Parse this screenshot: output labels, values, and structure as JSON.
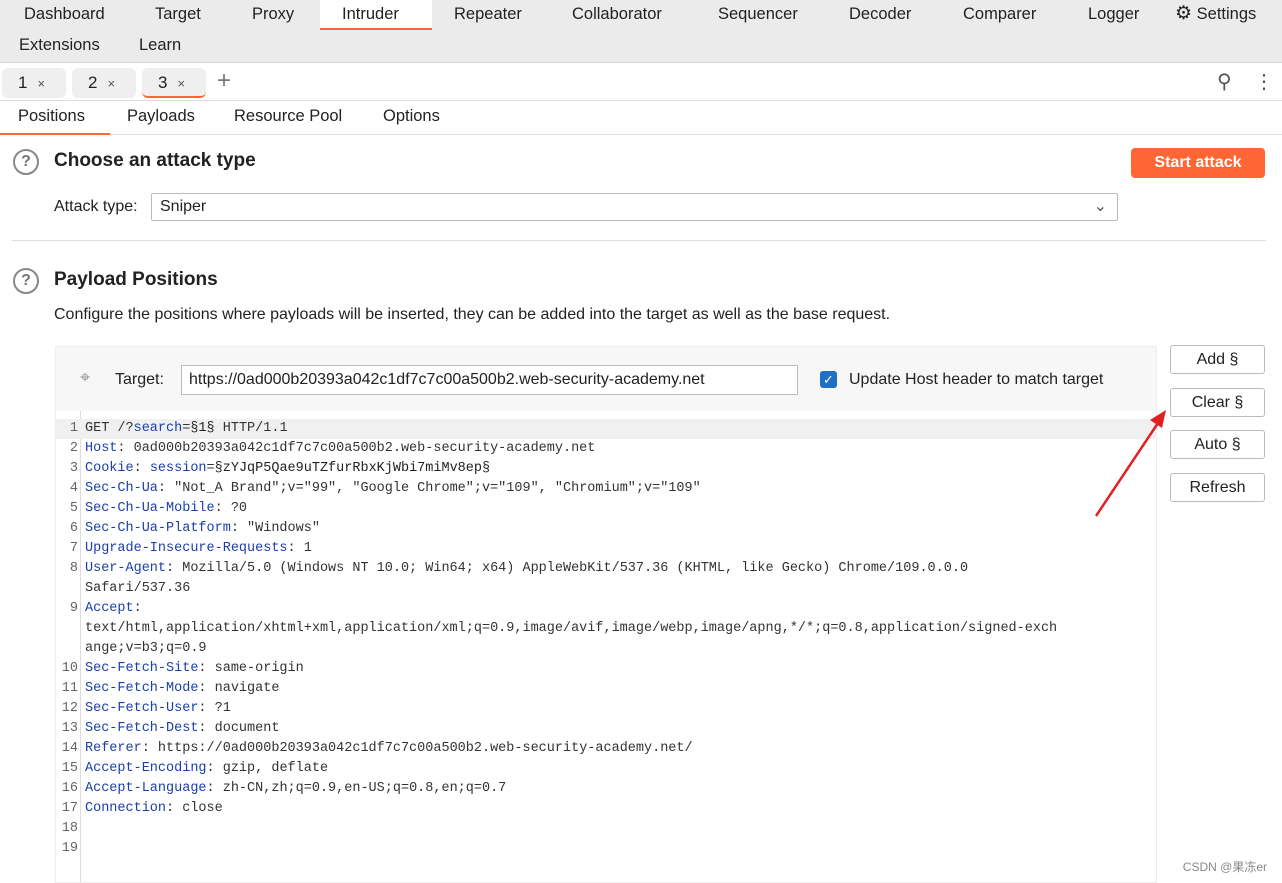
{
  "nav": {
    "items": [
      "Dashboard",
      "Target",
      "Proxy",
      "Intruder",
      "Repeater",
      "Collaborator",
      "Sequencer",
      "Decoder",
      "Comparer",
      "Logger",
      "Settings",
      "Extensions",
      "Learn"
    ],
    "active": "Intruder"
  },
  "tabs": {
    "items": [
      "1",
      "2",
      "3"
    ],
    "close": "×",
    "active": "3",
    "add": "+"
  },
  "subtabs": {
    "items": [
      "Positions",
      "Payloads",
      "Resource Pool",
      "Options"
    ],
    "active": "Positions"
  },
  "attack": {
    "title": "Choose an attack type",
    "type_label": "Attack type:",
    "type_value": "Sniper",
    "start_label": "Start attack",
    "accent": "#ff6633"
  },
  "positions": {
    "title": "Payload Positions",
    "description": "Configure the positions where payloads will be inserted, they can be added into the target as well as the base request.",
    "target_label": "Target:",
    "target_value": "https://0ad000b20393a042c1df7c7c00a500b2.web-security-academy.net",
    "update_host_label": "Update Host header to match target",
    "update_host_checked": true
  },
  "side_buttons": {
    "add": "Add §",
    "clear": "Clear §",
    "auto": "Auto §",
    "refresh": "Refresh"
  },
  "request": [
    {
      "n": "1",
      "parts": [
        [
          "p",
          "GET /?"
        ],
        [
          "k",
          "search"
        ],
        [
          "p",
          "="
        ],
        [
          "m",
          "§1§"
        ],
        [
          "p",
          " HTTP/1.1"
        ]
      ]
    },
    {
      "n": "2",
      "parts": [
        [
          "k",
          "Host"
        ],
        [
          "p",
          ": 0ad000b20393a042c1df7c7c00a500b2.web-security-academy.net"
        ]
      ]
    },
    {
      "n": "3",
      "parts": [
        [
          "k",
          "Cookie"
        ],
        [
          "p",
          ": "
        ],
        [
          "k",
          "session"
        ],
        [
          "p",
          "="
        ],
        [
          "m",
          "§zYJqP5Qae9uTZfurRbxKjWbi7miMv8ep§"
        ]
      ]
    },
    {
      "n": "4",
      "parts": [
        [
          "k",
          "Sec-Ch-Ua"
        ],
        [
          "p",
          ": \"Not_A Brand\";v=\"99\", \"Google Chrome\";v=\"109\", \"Chromium\";v=\"109\""
        ]
      ]
    },
    {
      "n": "5",
      "parts": [
        [
          "k",
          "Sec-Ch-Ua-Mobile"
        ],
        [
          "p",
          ": ?0"
        ]
      ]
    },
    {
      "n": "6",
      "parts": [
        [
          "k",
          "Sec-Ch-Ua-Platform"
        ],
        [
          "p",
          ": \"Windows\""
        ]
      ]
    },
    {
      "n": "7",
      "parts": [
        [
          "k",
          "Upgrade-Insecure-Requests"
        ],
        [
          "p",
          ": 1"
        ]
      ]
    },
    {
      "n": "8",
      "parts": [
        [
          "k",
          "User-Agent"
        ],
        [
          "p",
          ": Mozilla/5.0 (Windows NT 10.0; Win64; x64) AppleWebKit/537.36 (KHTML, like Gecko) Chrome/109.0.0.0"
        ]
      ]
    },
    {
      "n": "",
      "parts": [
        [
          "p",
          "Safari/537.36"
        ]
      ]
    },
    {
      "n": "9",
      "parts": [
        [
          "k",
          "Accept"
        ],
        [
          "p",
          ":"
        ]
      ]
    },
    {
      "n": "",
      "parts": [
        [
          "p",
          "text/html,application/xhtml+xml,application/xml;q=0.9,image/avif,image/webp,image/apng,*/*;q=0.8,application/signed-exch"
        ]
      ]
    },
    {
      "n": "",
      "parts": [
        [
          "p",
          "ange;v=b3;q=0.9"
        ]
      ]
    },
    {
      "n": "10",
      "parts": [
        [
          "k",
          "Sec-Fetch-Site"
        ],
        [
          "p",
          ": same-origin"
        ]
      ]
    },
    {
      "n": "11",
      "parts": [
        [
          "k",
          "Sec-Fetch-Mode"
        ],
        [
          "p",
          ": navigate"
        ]
      ]
    },
    {
      "n": "12",
      "parts": [
        [
          "k",
          "Sec-Fetch-User"
        ],
        [
          "p",
          ": ?1"
        ]
      ]
    },
    {
      "n": "13",
      "parts": [
        [
          "k",
          "Sec-Fetch-Dest"
        ],
        [
          "p",
          ": document"
        ]
      ]
    },
    {
      "n": "14",
      "parts": [
        [
          "k",
          "Referer"
        ],
        [
          "p",
          ": https://0ad000b20393a042c1df7c7c00a500b2.web-security-academy.net/"
        ]
      ]
    },
    {
      "n": "15",
      "parts": [
        [
          "k",
          "Accept-Encoding"
        ],
        [
          "p",
          ": gzip, deflate"
        ]
      ]
    },
    {
      "n": "16",
      "parts": [
        [
          "k",
          "Accept-Language"
        ],
        [
          "p",
          ": zh-CN,zh;q=0.9,en-US;q=0.8,en;q=0.7"
        ]
      ]
    },
    {
      "n": "17",
      "parts": [
        [
          "k",
          "Connection"
        ],
        [
          "p",
          ": close"
        ]
      ]
    },
    {
      "n": "18",
      "parts": []
    },
    {
      "n": "19",
      "parts": []
    }
  ],
  "watermark": "CSDN @果冻er"
}
